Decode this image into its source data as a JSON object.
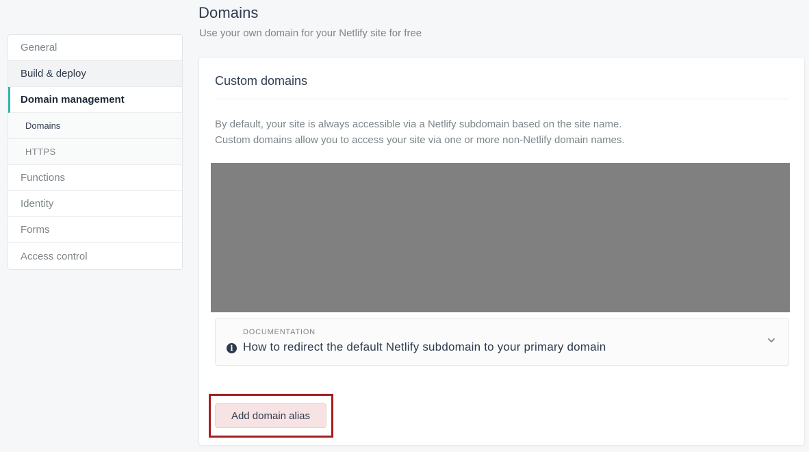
{
  "header": {
    "title": "Domains",
    "subtitle": "Use your own domain for your Netlify site for free"
  },
  "sidebar": {
    "items": [
      {
        "label": "General"
      },
      {
        "label": "Build & deploy"
      },
      {
        "label": "Domain management"
      },
      {
        "label": "Domains"
      },
      {
        "label": "HTTPS"
      },
      {
        "label": "Functions"
      },
      {
        "label": "Identity"
      },
      {
        "label": "Forms"
      },
      {
        "label": "Access control"
      }
    ],
    "accent_color": "#2fb5a8"
  },
  "custom_domains": {
    "title": "Custom domains",
    "description_line1": "By default, your site is always accessible via a Netlify subdomain based on the site name.",
    "description_line2": "Custom domains allow you to access your site via one or more non-Netlify domain names.",
    "documentation": {
      "kicker": "DOCUMENTATION",
      "link_text": "How to redirect the default Netlify subdomain to your primary domain",
      "icon": "info-icon",
      "toggle_icon": "chevron-down-icon"
    },
    "add_alias_label": "Add domain alias",
    "highlight_color": "#a51d1d"
  }
}
